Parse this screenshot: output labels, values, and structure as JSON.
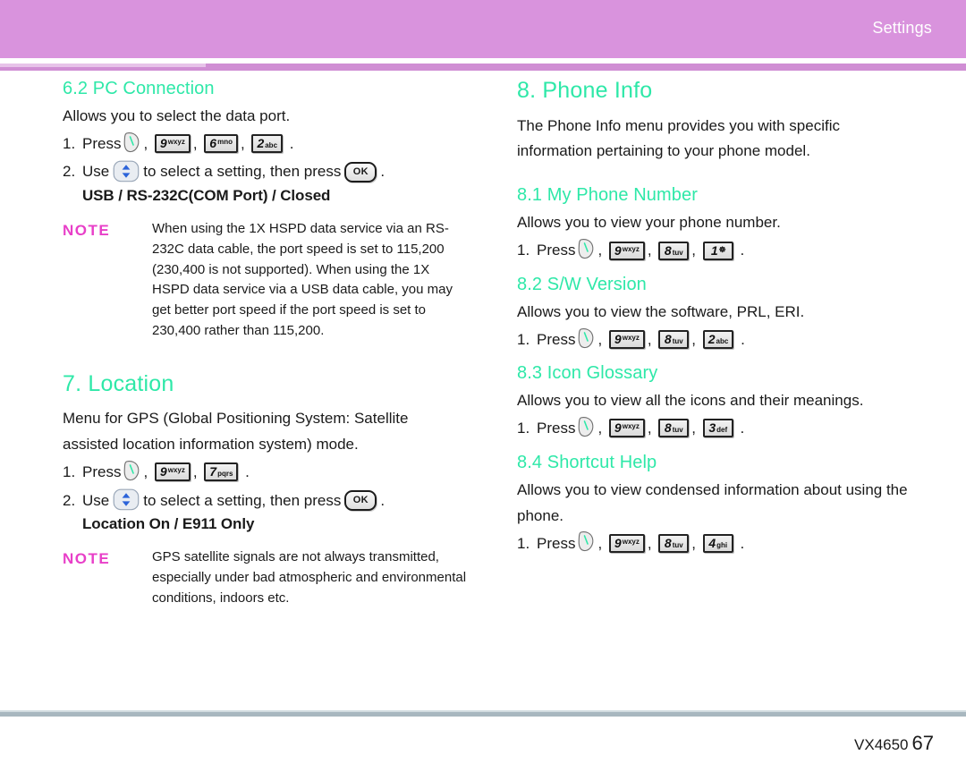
{
  "header": {
    "title": "Settings"
  },
  "footer": {
    "model": "VX4650",
    "page": "67"
  },
  "left_column": {
    "section_pc": {
      "heading": "6.2 PC Connection",
      "intro": "Allows you to select the data port.",
      "step1_num": "1.",
      "step1_label": "Press",
      "step2_num": "2.",
      "step2_label": "Use",
      "step2_mid": "to select a setting, then press",
      "step2_end": ".",
      "options": "USB / RS-232C(COM Port) / Closed",
      "keys": [
        {
          "digit": "9",
          "sub": "wxyz"
        },
        {
          "digit": "6",
          "sub": "mno"
        },
        {
          "digit": "2",
          "sub": "abc"
        }
      ],
      "ok_label": "OK"
    },
    "note_pc": {
      "label": "NOTE",
      "lines": [
        "When using the 1X HSPD data service via an RS-",
        "232C data cable, the port speed is set to 115,200",
        "(230,400 is not supported). When using the 1X",
        "HSPD data service via a USB data cable, you may",
        "get better port speed if the port speed is set to",
        "230,400 rather than 115,200."
      ]
    },
    "section_location": {
      "heading": "7. Location",
      "intro_line1": "Menu  for  GPS  (Global  Positioning  System:  Satellite",
      "intro_line2": "assisted location information system) mode.",
      "step1_num": "1.",
      "step1_label": "Press",
      "step2_num": "2.",
      "step2_label": "Use",
      "step2_mid": "to select a setting, then press",
      "step2_end": ".",
      "options": "Location On / E911 Only",
      "keys": [
        {
          "digit": "9",
          "sub": "wxyz"
        },
        {
          "digit": "7",
          "sub": "pqrs"
        }
      ],
      "ok_label": "OK"
    },
    "note_location": {
      "label": "NOTE",
      "lines": [
        "GPS satellite signals are not always transmitted,",
        "especially under bad atmospheric and environmental",
        "conditions, indoors etc."
      ]
    }
  },
  "right_column": {
    "section_phone_info": {
      "heading": "8. Phone Info",
      "intro_line1": "The   Phone   Info   menu   provides   you   with   specific",
      "intro_line2": "information pertaining to your phone model."
    },
    "section_my_number": {
      "heading": "8.1 My Phone Number",
      "intro": "Allows you to view your phone number.",
      "step_num": "1.",
      "step_label": "Press",
      "keys": [
        {
          "digit": "9",
          "sub": "wxyz"
        },
        {
          "digit": "8",
          "sub": "tuv"
        },
        {
          "digit": "1",
          "sub": "☸"
        }
      ]
    },
    "section_sw_version": {
      "heading": "8.2 S/W Version",
      "intro": "Allows you to view the software, PRL, ERI.",
      "step_num": "1.",
      "step_label": "Press",
      "keys": [
        {
          "digit": "9",
          "sub": "wxyz"
        },
        {
          "digit": "8",
          "sub": "tuv"
        },
        {
          "digit": "2",
          "sub": "abc"
        }
      ]
    },
    "section_icon_glossary": {
      "heading": "8.3 Icon Glossary",
      "intro": "Allows you to view all the icons and their meanings.",
      "step_num": "1.",
      "step_label": "Press",
      "keys": [
        {
          "digit": "9",
          "sub": "wxyz"
        },
        {
          "digit": "8",
          "sub": "tuv"
        },
        {
          "digit": "3",
          "sub": "def"
        }
      ]
    },
    "section_shortcut_help": {
      "heading": "8.4 Shortcut Help",
      "intro_line1": "Allows you to view condensed information about using the",
      "intro_line2": "phone.",
      "step_num": "1.",
      "step_label": "Press",
      "keys": [
        {
          "digit": "9",
          "sub": "wxyz"
        },
        {
          "digit": "8",
          "sub": "tuv"
        },
        {
          "digit": "4",
          "sub": "ghi"
        }
      ]
    }
  },
  "colors": {
    "header_band": "#d993dd",
    "heading_teal": "#2ee8a8",
    "note_magenta": "#e83fc8",
    "footer_rule": "#a8b7bf"
  }
}
